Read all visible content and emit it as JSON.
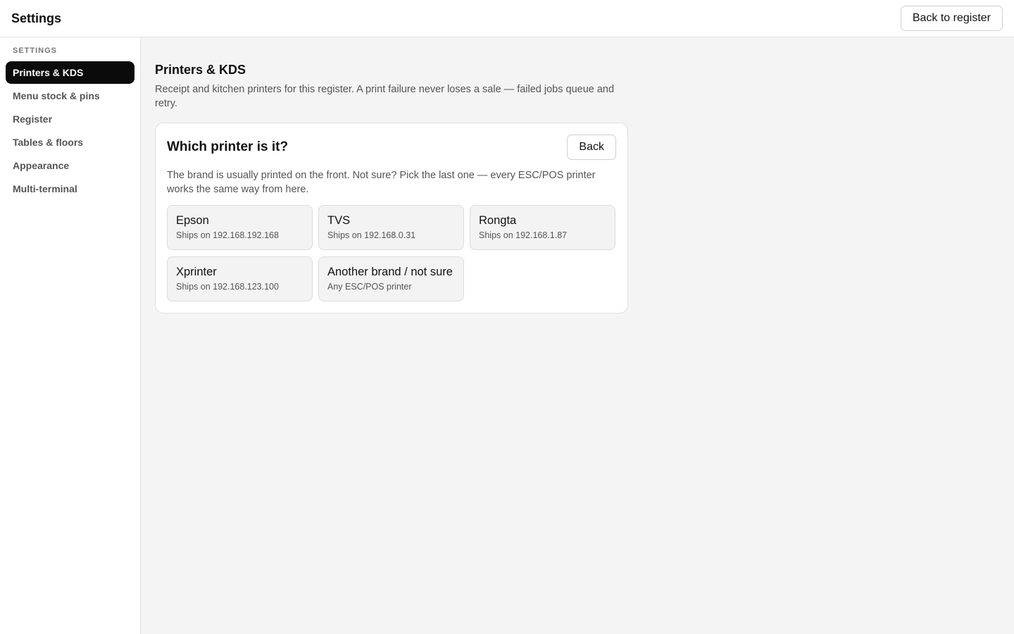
{
  "header": {
    "title": "Settings",
    "back_to_register_label": "Back to register"
  },
  "sidebar": {
    "heading": "SETTINGS",
    "items": [
      {
        "label": "Printers & KDS",
        "active": true
      },
      {
        "label": "Menu stock & pins",
        "active": false
      },
      {
        "label": "Register",
        "active": false
      },
      {
        "label": "Tables & floors",
        "active": false
      },
      {
        "label": "Appearance",
        "active": false
      },
      {
        "label": "Multi-terminal",
        "active": false
      }
    ]
  },
  "main": {
    "title": "Printers & KDS",
    "description": "Receipt and kitchen printers for this register. A print failure never loses a sale — failed jobs queue and retry.",
    "card": {
      "title": "Which printer is it?",
      "back_label": "Back",
      "description": "The brand is usually printed on the front. Not sure? Pick the last one — every ESC/POS printer works the same way from here.",
      "options": [
        {
          "name": "Epson",
          "detail": "Ships on 192.168.192.168"
        },
        {
          "name": "TVS",
          "detail": "Ships on 192.168.0.31"
        },
        {
          "name": "Rongta",
          "detail": "Ships on 192.168.1.87"
        },
        {
          "name": "Xprinter",
          "detail": "Ships on 192.168.123.100"
        },
        {
          "name": "Another brand / not sure",
          "detail": "Any ESC/POS printer"
        }
      ]
    }
  },
  "colors": {
    "active_nav_bg": "#0b0b0b",
    "page_bg": "#f4f4f4",
    "tile_bg": "#f3f3f3"
  }
}
